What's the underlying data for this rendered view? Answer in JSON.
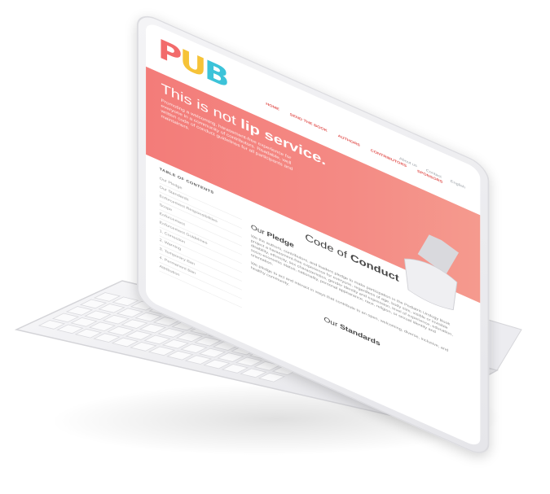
{
  "site": {
    "logo_text": [
      "P",
      "U",
      "B"
    ],
    "top_links": [
      "About us",
      "Contact",
      "English"
    ],
    "main_nav": [
      "Home",
      "Send the book",
      "Authors",
      "Contributors",
      "Sponsors"
    ],
    "hero": {
      "title_plain": "This is not ",
      "title_bold": "lip service.",
      "text": "Promoting a welcoming, harassment-free experience for everyone in a community of contributors. Readable, well written code of conduct guidelines for all participants and maintainers."
    },
    "toc": {
      "title": "TABLE OF CONTENTS",
      "items": [
        "Our Pledge",
        "Our Standards",
        "Enforcement Responsibilities",
        "Scope",
        "Enforcement",
        "Enforcement Guidelines",
        "1. Correction",
        "2. Warning",
        "3. Temporary Ban",
        "4. Permanent Ban",
        "Attribution"
      ]
    },
    "content": {
      "heading_plain": "Code of ",
      "heading_bold": "Conduct",
      "pledge_plain": "Our ",
      "pledge_bold": "Pledge",
      "pledge_text": "We the authors, contributors, and leaders pledge to make participation in the Pediatric Urology Book project a harassment-free experience for everyone, regardless of age, body size, visible or invisible disability, ethnicity, sex characteristics, gender identity and expression, level of experience, education, socio-economic status, nationality, personal appearance, race, religion, or sexual identity and orientation.",
      "pledge_text2": "We pledge to act and interact in ways that contribute to an open, welcoming, diverse, inclusive, and healthy community.",
      "standards_plain": "Our ",
      "standards_bold": "Standards"
    }
  },
  "colors": {
    "hero": "#f37c79",
    "accent": "#e35b58",
    "logo_p": "#f26b6b",
    "logo_u": "#f6c338",
    "logo_b": "#3cc3d9"
  }
}
